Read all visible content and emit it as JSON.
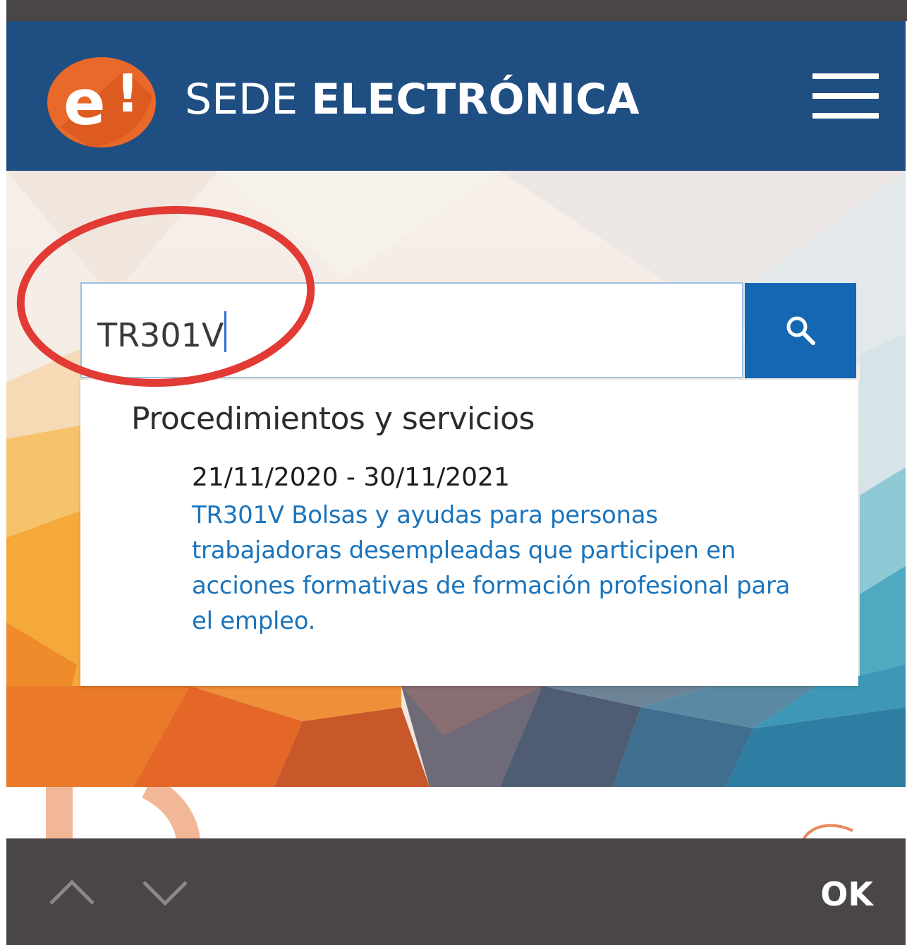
{
  "header": {
    "logo_glyph": "e!",
    "brand_light": "SEDE ",
    "brand_bold": "ELECTRÓNICA",
    "menu_icon": "hamburger-menu-icon"
  },
  "search": {
    "value": "TR301V",
    "button_icon": "search-icon"
  },
  "results": {
    "section_heading": "Procedimientos y servicios",
    "items": [
      {
        "date_range": "21/11/2020 - 30/11/2021",
        "title": "TR301V Bolsas y ayudas para personas trabajadoras desempleadas que participen en acciones formativas de formación profesional para el empleo."
      }
    ]
  },
  "keyboard_bar": {
    "prev_icon": "chevron-up-icon",
    "next_icon": "chevron-down-icon",
    "done_label": "OK"
  },
  "colors": {
    "header_bg": "#1f4e82",
    "search_button": "#1567b4",
    "link": "#1a74bc",
    "annotation": "#e23a34",
    "logo": "#e8692a"
  }
}
